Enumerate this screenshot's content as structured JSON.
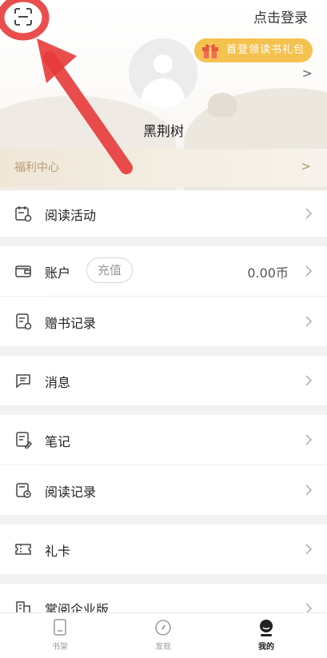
{
  "header": {
    "login_label": "点击登录",
    "gift_label": "首登领读书礼包",
    "username": "黑荆树",
    "profile_arrow": ">",
    "welfare_label": "福利中心",
    "welfare_arrow": ">"
  },
  "rows": {
    "reading_activity": "阅读活动",
    "account": "账户",
    "recharge": "充值",
    "balance": "0.00币",
    "gift_books": "赠书记录",
    "messages": "消息",
    "notes": "笔记",
    "reading_records": "阅读记录",
    "gift_card": "礼卡",
    "enterprise": "掌阅企业版"
  },
  "tabs": [
    {
      "label": "书架",
      "icon": "bookshelf-icon",
      "active": false
    },
    {
      "label": "发现",
      "icon": "discover-compass-icon",
      "active": false
    },
    {
      "label": "我的",
      "icon": "profile-icon",
      "active": true
    }
  ],
  "colors": {
    "accent_gold": "#f4c24f",
    "welfare_text": "#b79c72",
    "annotation_red": "#e83a3a"
  }
}
